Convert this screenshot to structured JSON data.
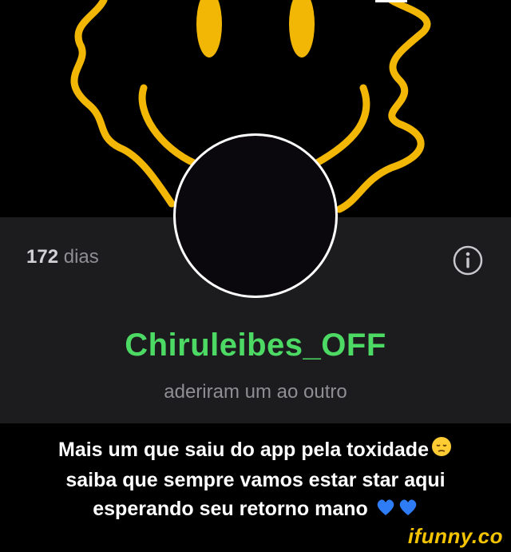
{
  "streak": {
    "count": "172",
    "unit": "dias"
  },
  "profile": {
    "username": "Chiruleibes_OFF",
    "relationship": "aderiram um ao outro"
  },
  "caption": {
    "line1": "Mais um que saiu do app pela toxidade",
    "line2": "saiba que sempre vamos estar star aqui",
    "line3": "esperando seu retorno mano"
  },
  "watermark": "ifunny.co",
  "icons": {
    "info": "info-icon",
    "pensive": "pensive-face-emoji",
    "heart": "blue-heart-emoji"
  },
  "colors": {
    "username": "#4cd964",
    "smiley": "#f2b705",
    "panel": "#1c1c1e"
  }
}
